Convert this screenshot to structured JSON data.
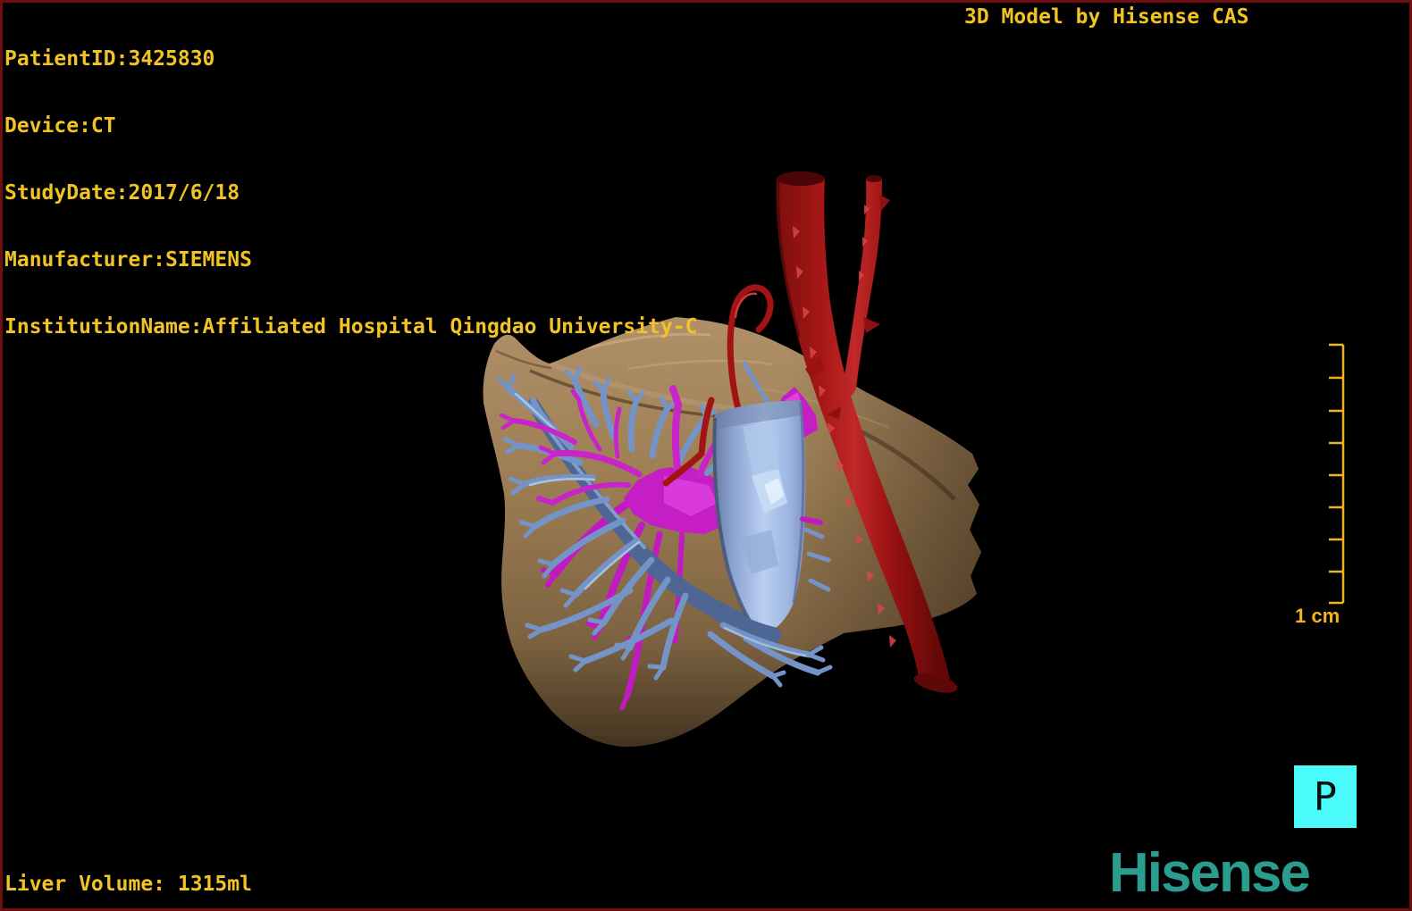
{
  "header": {
    "title_right": "3D Model by Hisense CAS"
  },
  "patient_info": {
    "lines": [
      "PatientID:3425830",
      "Device:CT",
      "StudyDate:2017/6/18",
      "Manufacturer:SIEMENS",
      "InstitutionName:Affiliated Hospital Qingdao University-C"
    ]
  },
  "footer": {
    "liver_volume": "Liver Volume: 1315ml",
    "brand_logo": "Hisense"
  },
  "viewport": {
    "orientation_marker": "P",
    "scale_label": "1 cm",
    "scale_intervals": 8
  },
  "colors": {
    "osd_text": "#F2C324",
    "border": "#6E0E0E",
    "background": "#000000",
    "brand_teal": "#2A9D8F",
    "orientation_marker_bg": "#4BFBFB",
    "liver": "#9A7B52",
    "portal_vein": "#7494C8",
    "hepatic_veins": "#C21AC2",
    "aorta": "#A71717",
    "hepatic_artery": "#A41313",
    "inferior_vena_cava": "#9FB8E2"
  },
  "model": {
    "structures": [
      {
        "id": "liver-parenchyma",
        "color": "#9A7B52"
      },
      {
        "id": "portal-vein",
        "color": "#7494C8"
      },
      {
        "id": "hepatic-veins",
        "color": "#C21AC2"
      },
      {
        "id": "abdominal-aorta",
        "color": "#A71717"
      },
      {
        "id": "hepatic-artery",
        "color": "#A41313"
      },
      {
        "id": "inferior-vena-cava",
        "color": "#9FB8E2"
      }
    ]
  }
}
